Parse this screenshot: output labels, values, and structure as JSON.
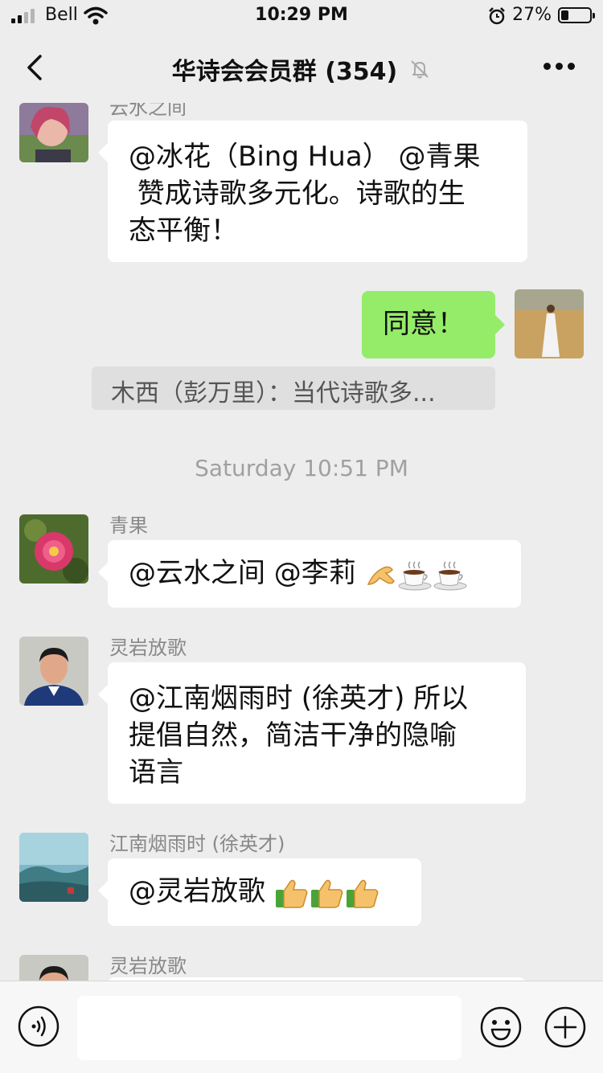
{
  "status_bar": {
    "carrier": "Bell",
    "time": "10:29 PM",
    "battery_percent": "27%"
  },
  "header": {
    "title": "华诗会会员群 (354)",
    "muted": true
  },
  "messages": [
    {
      "sender": "云水之间",
      "side": "left",
      "text_lines": [
        "@冰花（Bing Hua） @青果",
        " 赞成诗歌多元化。诗歌的生",
        "态平衡！"
      ]
    },
    {
      "side": "right",
      "text": "同意！"
    },
    {
      "quote": "木西（彭万里）：当代诗歌多..."
    },
    {
      "timestamp": "Saturday 10:51 PM"
    },
    {
      "sender": "青果",
      "side": "left",
      "text": "@云水之间 @李莉 ",
      "emoji": [
        "ok-hand",
        "coffee",
        "coffee"
      ]
    },
    {
      "sender": "灵岩放歌",
      "side": "left",
      "text_lines": [
        "@江南烟雨时 (徐英才) 所以",
        "提倡自然，简洁干净的隐喻",
        "语言"
      ]
    },
    {
      "sender": "江南烟雨时 (徐英才)",
      "side": "left",
      "text": "@灵岩放歌 ",
      "emoji": [
        "thumbs-up",
        "thumbs-up",
        "thumbs-up"
      ]
    },
    {
      "sender": "灵岩放歌",
      "side": "left"
    }
  ],
  "input": {
    "value": ""
  },
  "colors": {
    "background": "#ededed",
    "own_bubble": "#95ec69",
    "other_bubble": "#ffffff"
  }
}
